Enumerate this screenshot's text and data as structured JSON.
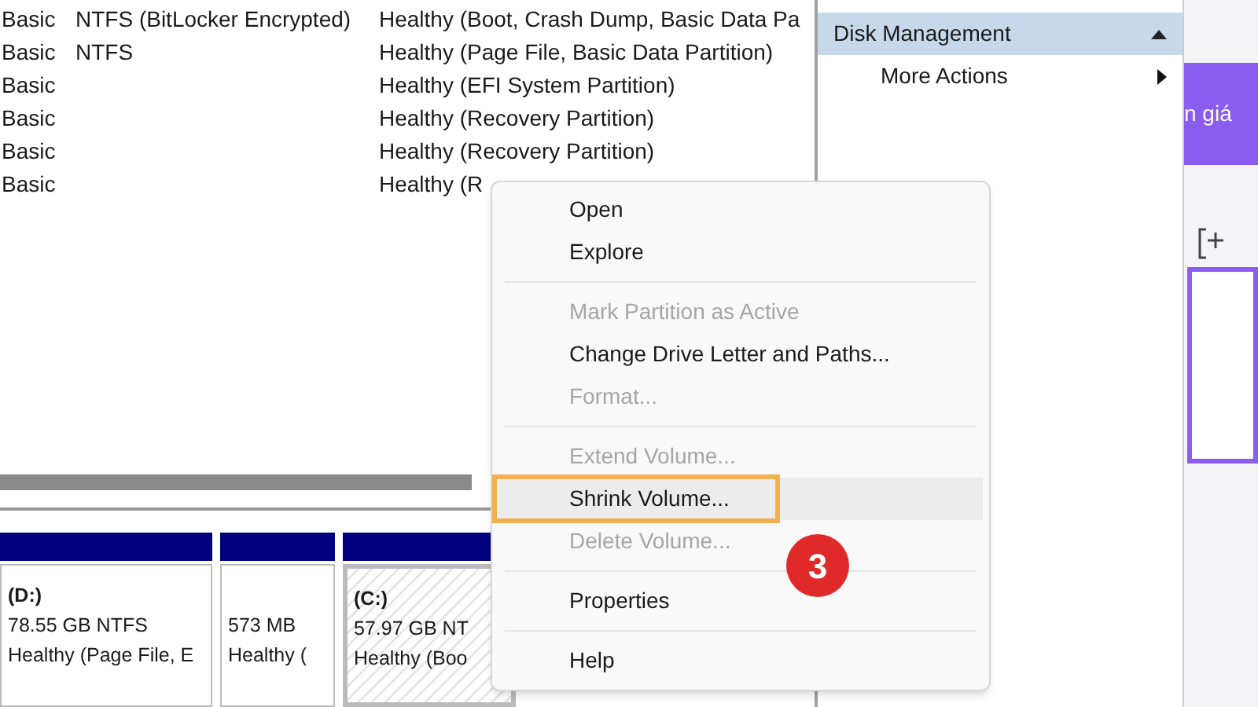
{
  "volumes": [
    {
      "type": "Basic",
      "file_system": "NTFS (BitLocker Encrypted)",
      "status": "Healthy (Boot, Crash Dump, Basic Data Pa"
    },
    {
      "type": "Basic",
      "file_system": "NTFS",
      "status": "Healthy (Page File, Basic Data Partition)"
    },
    {
      "type": "Basic",
      "status": "Healthy (EFI System Partition)"
    },
    {
      "type": "Basic",
      "status": "Healthy (Recovery Partition)"
    },
    {
      "type": "Basic",
      "status": "Healthy (Recovery Partition)"
    },
    {
      "type": "Basic",
      "status": "Healthy (R"
    }
  ],
  "disk_map": [
    {
      "label": "(D:)",
      "size": "78.55 GB NTFS",
      "status": "Healthy (Page File, E",
      "selected": false
    },
    {
      "size": "573 MB",
      "status": "Healthy (",
      "selected": false
    },
    {
      "label": "(C:)",
      "size": "57.97 GB NT",
      "status": "Healthy (Boo",
      "selected": true
    }
  ],
  "actions": {
    "header": "Disk Management",
    "items": [
      {
        "label": "More Actions"
      }
    ]
  },
  "background_app": {
    "text": "n giá"
  },
  "context_menu": [
    {
      "kind": "item",
      "label": "Open",
      "disabled": false,
      "selected": false
    },
    {
      "kind": "item",
      "label": "Explore",
      "disabled": false,
      "selected": false
    },
    {
      "kind": "separator"
    },
    {
      "kind": "item",
      "label": "Mark Partition as Active",
      "disabled": true,
      "selected": false
    },
    {
      "kind": "item",
      "label": "Change Drive Letter and Paths...",
      "disabled": false,
      "selected": false
    },
    {
      "kind": "item",
      "label": "Format...",
      "disabled": true,
      "selected": false
    },
    {
      "kind": "separator"
    },
    {
      "kind": "item",
      "label": "Extend Volume...",
      "disabled": true,
      "selected": false
    },
    {
      "kind": "item",
      "label": "Shrink Volume...",
      "disabled": false,
      "selected": true
    },
    {
      "kind": "item",
      "label": "Delete Volume...",
      "disabled": true,
      "selected": false
    },
    {
      "kind": "separator"
    },
    {
      "kind": "item",
      "label": "Properties",
      "disabled": false,
      "selected": false
    },
    {
      "kind": "separator"
    },
    {
      "kind": "item",
      "label": "Help",
      "disabled": false,
      "selected": false
    }
  ],
  "step_badge": "3"
}
